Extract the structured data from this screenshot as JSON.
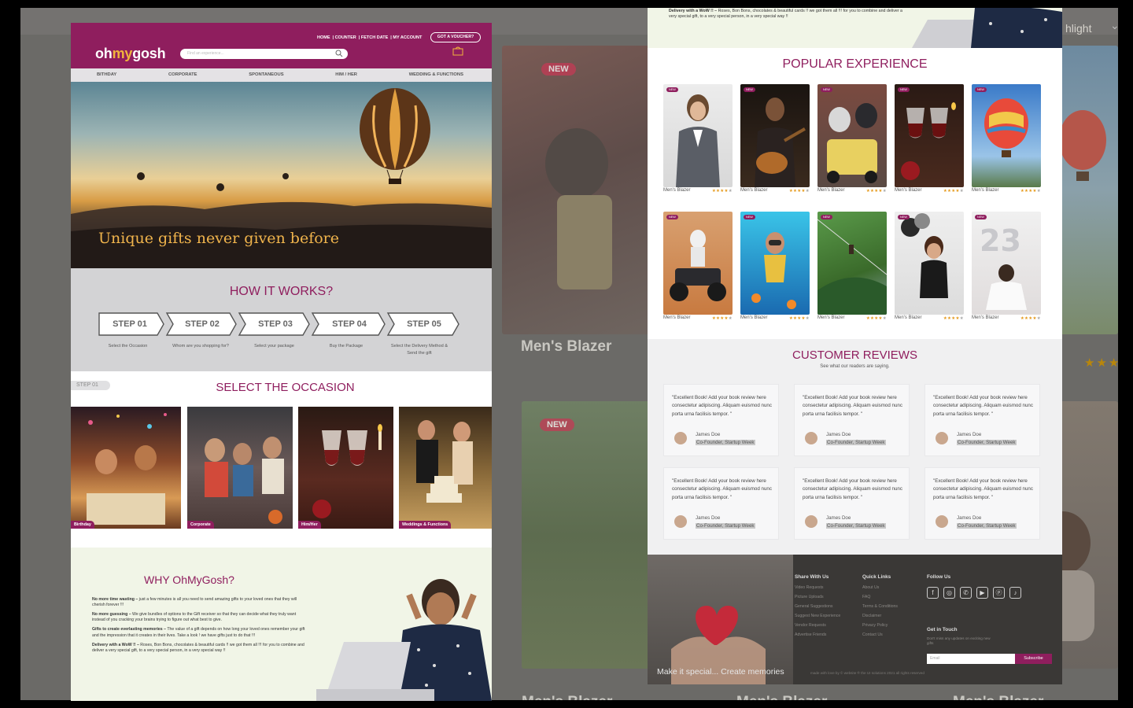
{
  "background": {
    "highlight_text": "hlight",
    "card_caption": "Men's Blazer",
    "new_badge": "NEW",
    "stars": "★★★"
  },
  "header": {
    "logo_part1": "oh",
    "logo_part2": "my",
    "logo_part3": "gosh",
    "nav": [
      "HOME",
      "COUNTER",
      "FETCH DATE",
      "MY ACCOUNT"
    ],
    "voucher_button": "GOT A VOUCHER?",
    "search_placeholder": "Find an experience..."
  },
  "categories": [
    "BITHDAY",
    "CORPORATE",
    "SPONTANEOUS",
    "HIM / HER",
    "WEDDING & FUNCTIONS"
  ],
  "hero": {
    "title": "Unique gifts never given before"
  },
  "how_it_works": {
    "title": "HOW IT WORKS?",
    "steps": [
      {
        "label": "STEP 01",
        "caption": "Select the Occasion"
      },
      {
        "label": "STEP 02",
        "caption": "Whom are you shopping for?"
      },
      {
        "label": "STEP 03",
        "caption": "Select your package"
      },
      {
        "label": "STEP 04",
        "caption": "Buy the Package"
      },
      {
        "label": "STEP 05",
        "caption": "Select the Delivery Method & Send the gift"
      }
    ]
  },
  "occasion": {
    "badge": "STEP 01",
    "title": "SELECT THE OCCASION",
    "cards": [
      "Birthday",
      "Corporate",
      "Him/Her",
      "Weddings & Functions"
    ]
  },
  "why": {
    "title": "WHY OhMyGosh?",
    "points": [
      {
        "bold": "No more time wasting –",
        "text": " just a few minutes is all you need to send amazing gifts to your loved ones that they will cherish forever !!!"
      },
      {
        "bold": "No more guessing –",
        "text": " We give bundles of options to the Gift receiver so that they can decide what they truly want instead of you cracking your brains trying to figure out what best to give."
      },
      {
        "bold": "Gifts to create everlasting memories –",
        "text": " The value of a gift depends on how long your loved ones remember your gift and the impression that it creates in their lives. Take a look ! we have gifts just to do that !!!"
      },
      {
        "bold": "Delivery with a WoW !! –",
        "text": " Roses, Bon Bons, chocolates & beautiful cards !! we got them all !!! for you to combine and deliver a very special gift, to a very special person, in a very special way !!"
      }
    ]
  },
  "right_top": {
    "bold": "Delivery with a WoW !! –",
    "text": " Roses, Bon Bons, chocolates & beautiful cards !! we got them all !!! for you to combine and deliver a very special gift, to a very special person, in a very special way !!"
  },
  "popular": {
    "title": "POPULAR EXPERIENCE",
    "new_badge": "NEW",
    "item_name": "Men's Blazer",
    "rating": 4,
    "stars_on": "★★★★",
    "stars_off": "★"
  },
  "reviews": {
    "title": "CUSTOMER REVIEWS",
    "subtitle": "See what our readers are saying.",
    "quote": "\"Excellent Book! Add your book review here consectetur adipiscing. Aliquam euismod nunc porta urna facilisis tempor. \"",
    "name": "James Doe",
    "role": "Co-Founder, Startup Week"
  },
  "footer": {
    "tagline": "Make it special... Create memories",
    "share_title": "Share With Us",
    "share_links": [
      "Video Requests",
      "Picture Uploads",
      "General Suggestions",
      "Suggest New Experience",
      "Vendor Requests",
      "Advertise Friends"
    ],
    "quick_title": "Quick Links",
    "quick_links": [
      "About Us",
      "FAQ",
      "Terms & Conditions",
      "Disclaimer",
      "Privacy Policy",
      "Contact Us"
    ],
    "follow_title": "Follow Us",
    "social_icons": [
      "f",
      "◎",
      "✆",
      "▶",
      "ⓟ",
      "♪"
    ],
    "touch_title": "Get in Touch",
    "touch_text": "Don't miss any updates on exciting new gifts",
    "email_placeholder": "Email",
    "subscribe": "Subscribe",
    "copyright": "made with love by © website ® the UI solutions 2021 all rights reserved"
  }
}
